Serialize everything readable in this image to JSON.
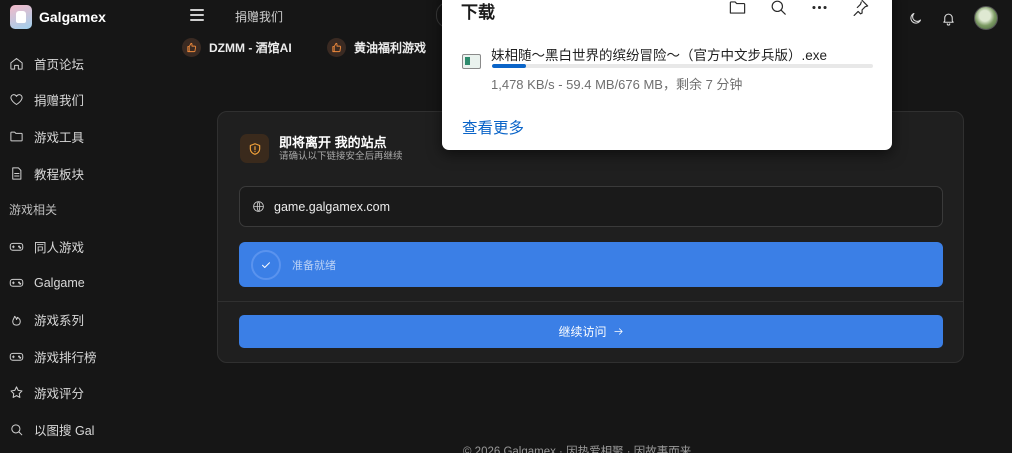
{
  "app": {
    "title": "Galgamex"
  },
  "sidebar": {
    "items": [
      {
        "label": "首页论坛",
        "icon": "home-icon"
      },
      {
        "label": "捐赠我们",
        "icon": "heart-icon"
      },
      {
        "label": "游戏工具",
        "icon": "folder-icon"
      },
      {
        "label": "教程板块",
        "icon": "document-icon"
      }
    ],
    "section_label": "游戏相关",
    "section_items": [
      {
        "label": "同人游戏",
        "icon": "gamepad-icon"
      },
      {
        "label": "Galgame",
        "icon": "gamepad-icon"
      },
      {
        "label": "游戏系列",
        "icon": "flame-icon"
      },
      {
        "label": "游戏排行榜",
        "icon": "gamepad-icon"
      },
      {
        "label": "游戏评分",
        "icon": "star-icon"
      },
      {
        "label": "以图搜 Gal",
        "icon": "search-icon"
      }
    ]
  },
  "topbar": {
    "link": "捐赠我们",
    "promos": [
      {
        "label": "DZMM - 酒馆AI",
        "icon": "thumbs-up-icon"
      },
      {
        "label": "黄油福利游戏",
        "icon": "thumbs-up-icon"
      }
    ],
    "icons": [
      "moon-icon",
      "bell-icon",
      "avatar"
    ]
  },
  "redirect_card": {
    "title": "即将离开 我的站点",
    "subtitle": "请确认以下链接安全后再继续",
    "url": "game.galgamex.com",
    "status": "准备就绪",
    "button": "继续访问"
  },
  "footer": {
    "text": "© 2026 Galgamex · 因热爱相聚 · 因故事而来"
  },
  "download_panel": {
    "title": "下载",
    "tools": [
      "open-folder-icon",
      "search-icon",
      "more-icon",
      "pin-icon"
    ],
    "file": {
      "name": "妹相随～黑白世界的缤纷冒险～（官方中文步兵版）.exe",
      "status": "1,478 KB/s - 59.4 MB/676 MB，剩余 7 分钟",
      "progress_percent": 8.8
    },
    "more_link": "查看更多"
  },
  "colors": {
    "accent": "#3b7fe6",
    "background": "#161616",
    "card": "#1f1f1f",
    "warning": "#f2a23a",
    "link": "#0a64c8"
  }
}
